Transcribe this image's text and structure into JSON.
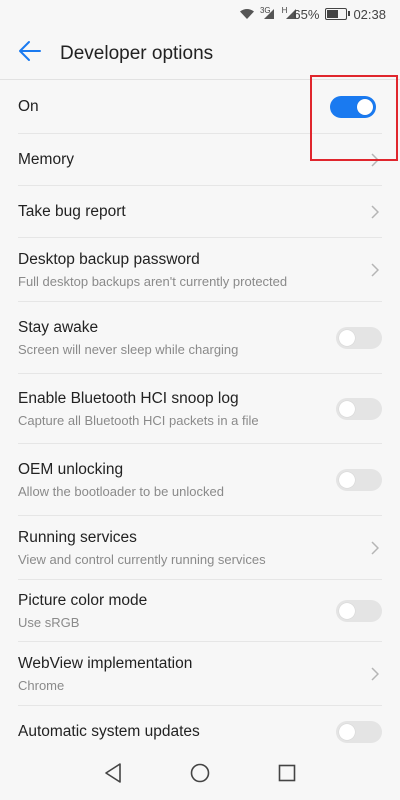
{
  "status_bar": {
    "network_1": "3G",
    "network_2": "H",
    "battery_percent": "65%",
    "time": "02:38",
    "icons": [
      "wifi-icon",
      "signal-icon",
      "signal-icon",
      "battery-icon"
    ]
  },
  "toolbar": {
    "title": "Developer options",
    "back_icon": "arrow-left-icon"
  },
  "accent_color": "#1a7af0",
  "highlight_color": "#e0262d",
  "items": [
    {
      "title": "On",
      "subtitle": "",
      "control": "toggle",
      "checked": true
    },
    {
      "title": "Memory",
      "subtitle": "",
      "control": "chevron"
    },
    {
      "title": "Take bug report",
      "subtitle": "",
      "control": "chevron"
    },
    {
      "title": "Desktop backup password",
      "subtitle": "Full desktop backups aren't currently protected",
      "control": "chevron"
    },
    {
      "title": "Stay awake",
      "subtitle": "Screen will never sleep while charging",
      "control": "toggle",
      "checked": false
    },
    {
      "title": "Enable Bluetooth HCI snoop log",
      "subtitle": "Capture all Bluetooth HCI packets in a file",
      "control": "toggle",
      "checked": false
    },
    {
      "title": "OEM unlocking",
      "subtitle": "Allow the bootloader to be unlocked",
      "control": "toggle",
      "checked": false
    },
    {
      "title": "Running services",
      "subtitle": "View and control currently running services",
      "control": "chevron"
    },
    {
      "title": "Picture color mode",
      "subtitle": "Use sRGB",
      "control": "toggle",
      "checked": false
    },
    {
      "title": "WebView implementation",
      "subtitle": "Chrome",
      "control": "chevron"
    },
    {
      "title": "Automatic system updates",
      "subtitle": "",
      "control": "toggle",
      "checked": false
    }
  ],
  "nav_bar": {
    "back_icon": "triangle-back-icon",
    "home_icon": "circle-home-icon",
    "recents_icon": "square-recents-icon"
  }
}
